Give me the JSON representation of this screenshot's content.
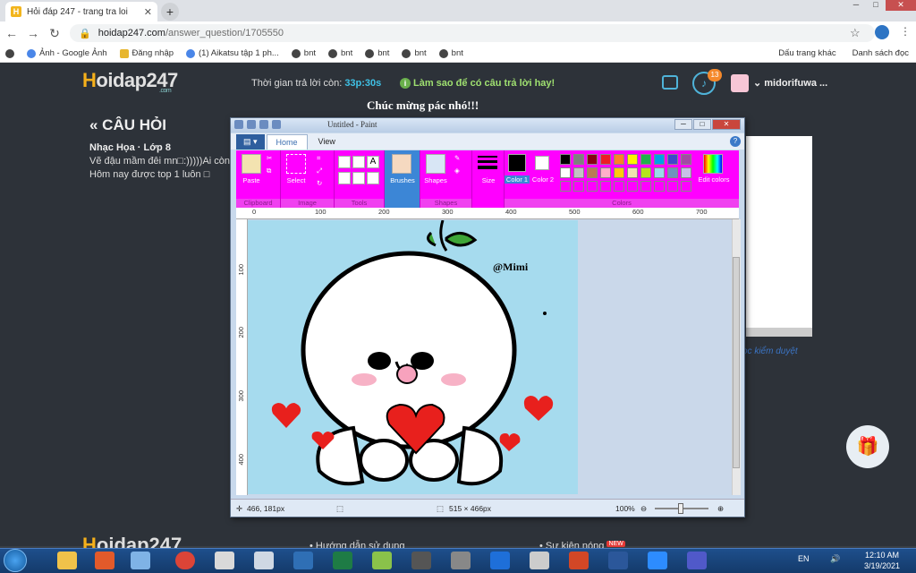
{
  "browser": {
    "tab_title": "Hỏi đáp 247 - trang tra loi",
    "tab_close": "✕",
    "new_tab": "+",
    "url_host": "hoidap247.com",
    "url_path": "/answer_question/1705550",
    "bookmarks": [
      "Ảnh - Google Ảnh",
      "Đăng nhập",
      "(1) Aikatsu tập 1 ph...",
      "bnt",
      "bnt",
      "bnt",
      "bnt",
      "bnt"
    ],
    "bookmarks_right": [
      "Dấu trang khác",
      "Danh sách đọc"
    ],
    "win_min": "─",
    "win_max": "□",
    "win_close": "✕"
  },
  "site": {
    "logo_a": "H",
    "logo_b": "oidap247",
    "logo_sub": ".com",
    "timer_label": "Thời gian trả lời còn:",
    "timer_value": "33p:30s",
    "howto_text": "Làm sao để có câu trả lời hay!",
    "notif_count": "13",
    "username": "midorifuwa ...",
    "question_header": "« CÂU HỎI",
    "question_meta": "Nhạc Họa · Lớp 8",
    "question_line1": "Vẽ đậu mầm đêi mn□:)))))Ai còn",
    "question_line2": "Hôm nay được top 1 luôn □",
    "congrats": "Chúc mừng pác nhó!!!",
    "review_text": "ọc kiểm duyệt",
    "footer_logo_a": "H",
    "footer_logo_b": "oidap247",
    "footer_link1": "Hướng dẫn sử dụng",
    "footer_link2": "Sự kiện nóng",
    "footer_new": "NEW"
  },
  "paint": {
    "title": "Untitled - Paint",
    "tabs": [
      "Home",
      "View"
    ],
    "groups": {
      "clipboard": "Clipboard",
      "paste": "Paste",
      "image": "Image",
      "select": "Select",
      "tools": "Tools",
      "brushes": "Brushes",
      "shapes_btn": "Shapes",
      "shapes": "Shapes",
      "size": "Size",
      "color1": "Color 1",
      "color2": "Color 2",
      "colors": "Colors",
      "edit_colors": "Edit colors"
    },
    "palette": [
      "#000000",
      "#7f7f7f",
      "#880015",
      "#ed1c24",
      "#ff7f27",
      "#fff200",
      "#22b14c",
      "#00a2e8",
      "#3f48cc",
      "#a349a4",
      "#ffffff",
      "#c3c3c3",
      "#b97a57",
      "#ffaec9",
      "#ffc90e",
      "#efe4b0",
      "#b5e61d",
      "#99d9ea",
      "#7092be",
      "#c8bfe7"
    ],
    "ruler_top": [
      "0",
      "100",
      "200",
      "300",
      "400",
      "500",
      "600",
      "700"
    ],
    "ruler_left": [
      "100",
      "200",
      "300",
      "400"
    ],
    "watermark": "@Mimi",
    "cursor_pos": "466, 181px",
    "canvas_size": "515 × 466px",
    "zoom": "100%"
  },
  "taskbar": {
    "lang": "EN",
    "time": "12:10 AM",
    "date": "3/19/2021"
  }
}
